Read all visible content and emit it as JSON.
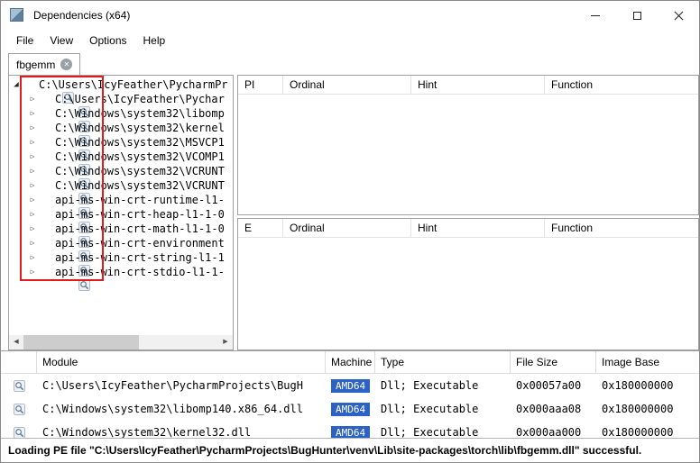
{
  "window": {
    "title": "Dependencies (x64)"
  },
  "menu": {
    "items": [
      "File",
      "View",
      "Options",
      "Help"
    ]
  },
  "tabs": [
    {
      "label": "fbgemm"
    }
  ],
  "tree": {
    "items": [
      {
        "label": "C:\\Users\\IcyFeather\\PycharmPr",
        "level": 0,
        "expanded": true
      },
      {
        "label": "C:\\Users\\IcyFeather\\Pychar",
        "level": 1,
        "expanded": false
      },
      {
        "label": "C:\\Windows\\system32\\libomp",
        "level": 1,
        "expanded": false
      },
      {
        "label": "C:\\Windows\\system32\\kernel",
        "level": 1,
        "expanded": false
      },
      {
        "label": "C:\\Windows\\system32\\MSVCP1",
        "level": 1,
        "expanded": false
      },
      {
        "label": "C:\\Windows\\system32\\VCOMP1",
        "level": 1,
        "expanded": false
      },
      {
        "label": "C:\\Windows\\system32\\VCRUNT",
        "level": 1,
        "expanded": false
      },
      {
        "label": "C:\\Windows\\system32\\VCRUNT",
        "level": 1,
        "expanded": false
      },
      {
        "label": "api-ms-win-crt-runtime-l1-",
        "level": 1,
        "expanded": false
      },
      {
        "label": "api-ms-win-crt-heap-l1-1-0",
        "level": 1,
        "expanded": false
      },
      {
        "label": "api-ms-win-crt-math-l1-1-0",
        "level": 1,
        "expanded": false
      },
      {
        "label": "api-ms-win-crt-environment",
        "level": 1,
        "expanded": false
      },
      {
        "label": "api-ms-win-crt-string-l1-1",
        "level": 1,
        "expanded": false
      },
      {
        "label": "api-ms-win-crt-stdio-l1-1-",
        "level": 1,
        "expanded": false
      }
    ]
  },
  "imports_panel": {
    "columns": [
      "PI",
      "Ordinal",
      "Hint",
      "Function"
    ]
  },
  "exports_panel": {
    "columns": [
      "E",
      "Ordinal",
      "Hint",
      "Function"
    ]
  },
  "modules_panel": {
    "columns": [
      "",
      "Module",
      "Machine",
      "Type",
      "File Size",
      "Image Base"
    ],
    "rows": [
      {
        "module": "C:\\Users\\IcyFeather\\PycharmProjects\\BugH",
        "machine": "AMD64",
        "type": "Dll; Executable",
        "file_size": "0x00057a00",
        "image_base": "0x180000000"
      },
      {
        "module": "C:\\Windows\\system32\\libomp140.x86_64.dll",
        "machine": "AMD64",
        "type": "Dll; Executable",
        "file_size": "0x000aaa08",
        "image_base": "0x180000000"
      },
      {
        "module": "C:\\Windows\\system32\\kernel32.dll",
        "machine": "AMD64",
        "type": "Dll; Executable",
        "file_size": "0x000aa000",
        "image_base": "0x180000000"
      }
    ]
  },
  "status_bar": {
    "text": "Loading PE file \"C:\\Users\\IcyFeather\\PycharmProjects\\BugHunter\\venv\\Lib\\site-packages\\torch\\lib\\fbgemm.dll\" successful."
  },
  "colors": {
    "machine_badge": "#2b62c4",
    "annotation": "#e01b1b"
  }
}
